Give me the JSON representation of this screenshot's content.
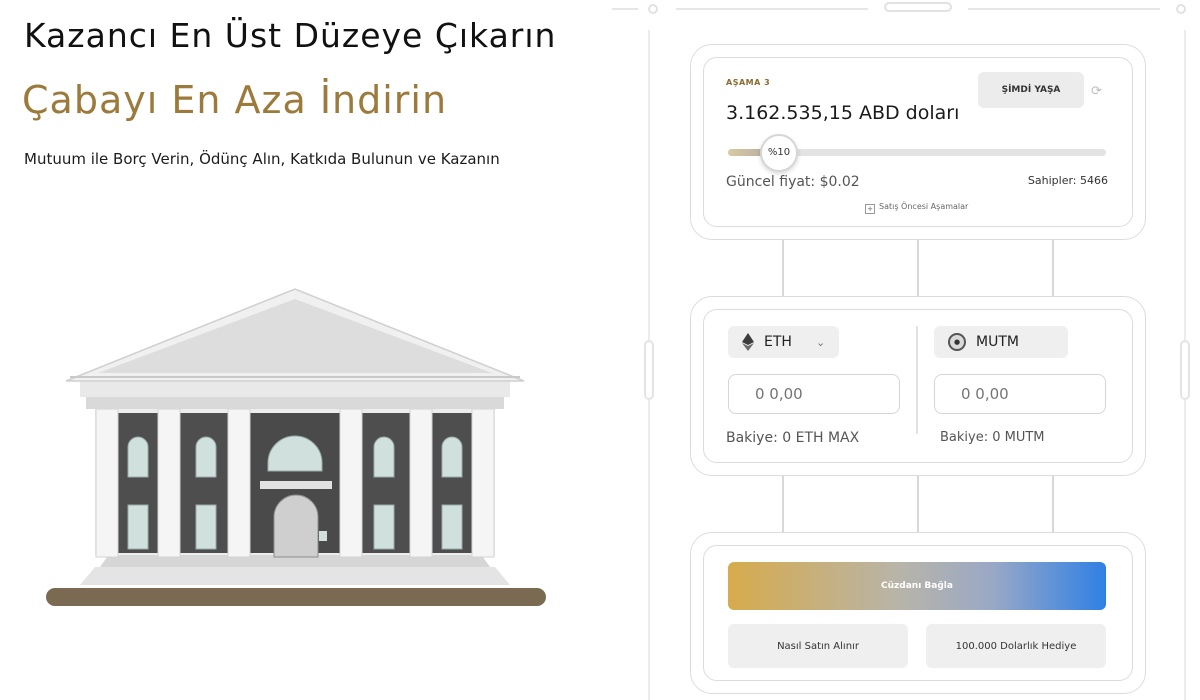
{
  "hero": {
    "title": "Kazancı En Üst Düzeye Çıkarın",
    "subtitle": "Çabayı En Aza İndirin",
    "tagline": "Mutuum ile Borç Verin, Ödünç Alın, Katkıda Bulunun ve Kazanın"
  },
  "presale": {
    "stage_label": "AŞAMA 3",
    "buy_now_label": "ŞİMDİ YAŞA",
    "refresh_icon": "refresh-icon",
    "raised_amount": "3.162.535,15 ABD doları",
    "progress_percent": 10,
    "progress_label": "%10",
    "current_price": "Güncel fiyat: $0.02",
    "holders": "Sahipler: 5466",
    "stages_link": "Satış Öncesi Aşamalar"
  },
  "swap": {
    "pay_token": {
      "label": "ETH",
      "icon": "ethereum-icon",
      "chevron": "⌄"
    },
    "receive_token": {
      "label": "MUTM",
      "icon": "mutm-coin-icon"
    },
    "pay_amount": "0 0,00",
    "receive_amount": "0 0,00",
    "pay_balance": "Bakiye: 0 ETH MAX",
    "receive_balance": "Bakiye: 0 MUTM"
  },
  "actions": {
    "connect_wallet": "Cüzdanı Bağla",
    "how_to_buy": "Nasıl Satın Alınır",
    "giveaway": "100.000 Dolarlık Hediye"
  },
  "colors": {
    "accent_gold": "#9c7a3c",
    "gradient_start": "#d7ab4c",
    "gradient_end": "#2f80e4"
  }
}
